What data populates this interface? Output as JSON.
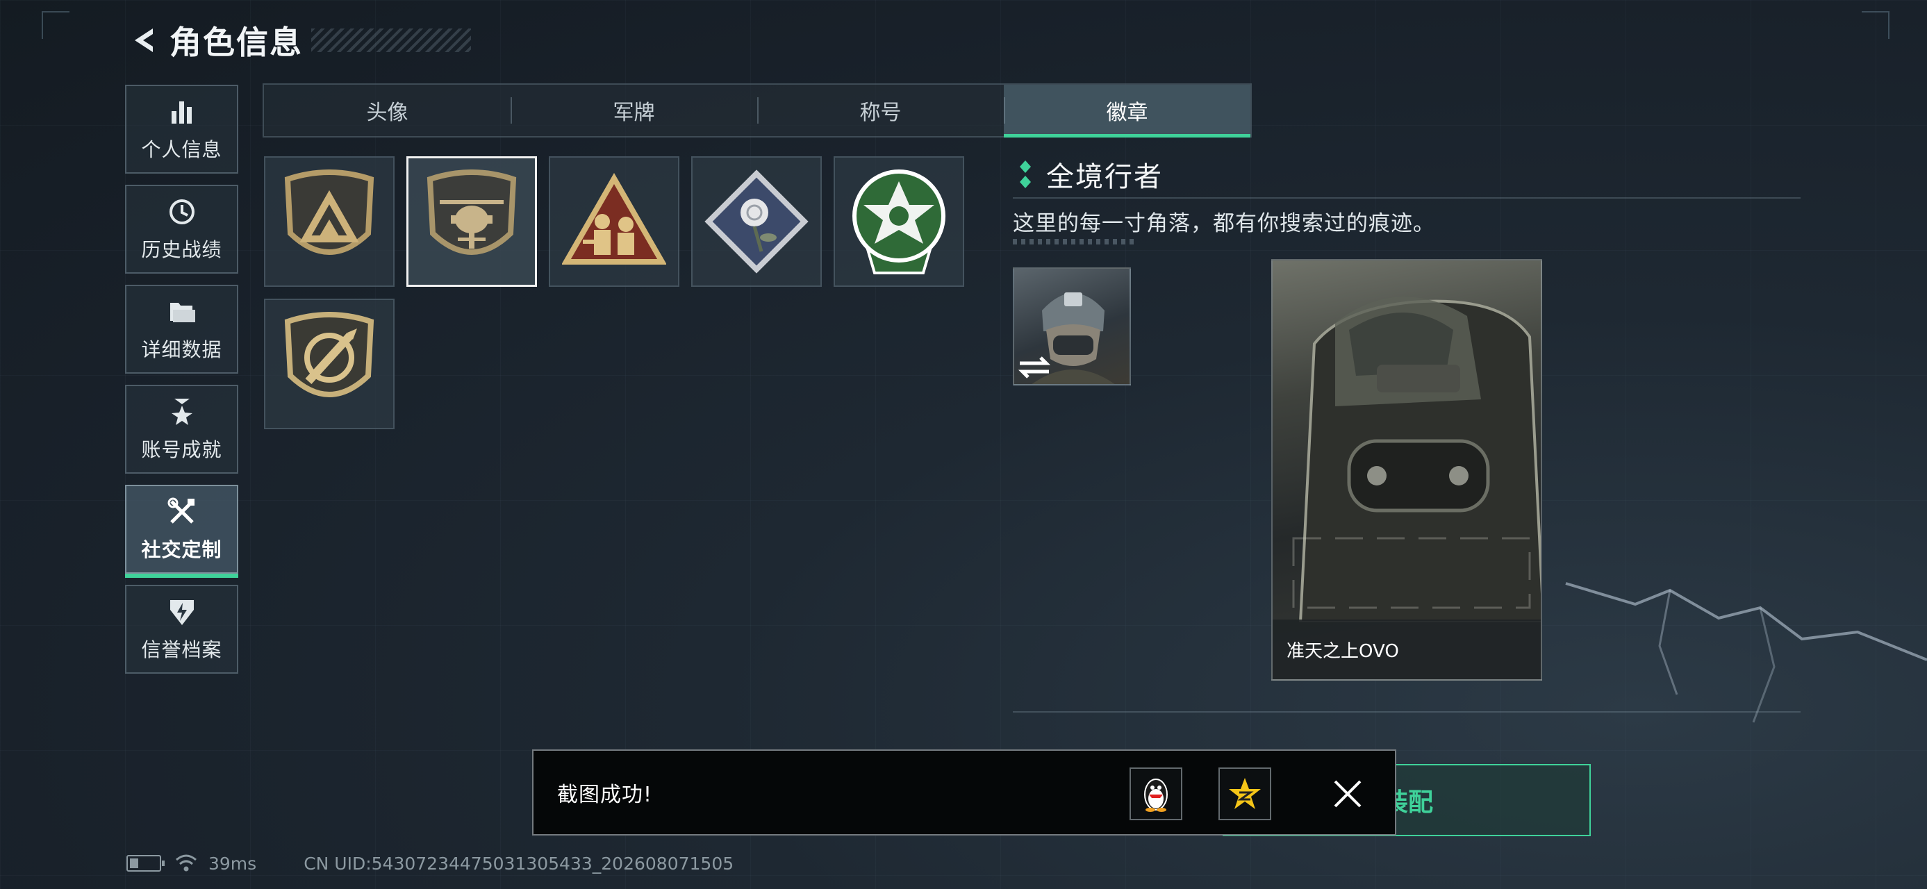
{
  "header": {
    "title": "角色信息",
    "back_icon": "chevron-left-icon"
  },
  "left_nav": [
    {
      "label": "个人信息",
      "icon": "bar-chart-icon",
      "active": false
    },
    {
      "label": "历史战绩",
      "icon": "history-clock-icon",
      "active": false
    },
    {
      "label": "详细数据",
      "icon": "folder-icon",
      "active": false
    },
    {
      "label": "账号成就",
      "icon": "achievement-medal-icon",
      "active": false
    },
    {
      "label": "社交定制",
      "icon": "tools-icon",
      "active": true
    },
    {
      "label": "信誉档案",
      "icon": "reputation-shield-icon",
      "active": false
    }
  ],
  "tabs": [
    {
      "label": "头像",
      "active": false
    },
    {
      "label": "军牌",
      "active": false
    },
    {
      "label": "称号",
      "active": false
    },
    {
      "label": "徽章",
      "active": true
    }
  ],
  "badges": [
    {
      "icon": "triangle-shield-badge-icon",
      "selected": false
    },
    {
      "icon": "helicopter-shield-badge-icon",
      "selected": true
    },
    {
      "icon": "soldiers-triangle-badge-icon",
      "selected": false
    },
    {
      "icon": "rose-diamond-badge-icon",
      "selected": false
    },
    {
      "icon": "green-star-circle-badge-icon",
      "selected": false
    },
    {
      "icon": "bullet-scope-shield-badge-icon",
      "selected": false
    }
  ],
  "detail": {
    "title": "全境行者",
    "description": "这里的每一寸角落，都有你搜索过的痕迹。",
    "card_caption": "准天之上OVO"
  },
  "equip_button": {
    "label": "装配"
  },
  "toast": {
    "message": "截图成功!",
    "share_icons": [
      "qq-penguin-icon",
      "qzone-star-icon"
    ],
    "close_icon": "close-icon"
  },
  "status_bar": {
    "ping": "39ms",
    "uid": "CN UID:543072344750313054​33_202608071505"
  },
  "colors": {
    "accent": "#3fd29a",
    "background": "#1b242d",
    "toast_bg": "#050708"
  }
}
